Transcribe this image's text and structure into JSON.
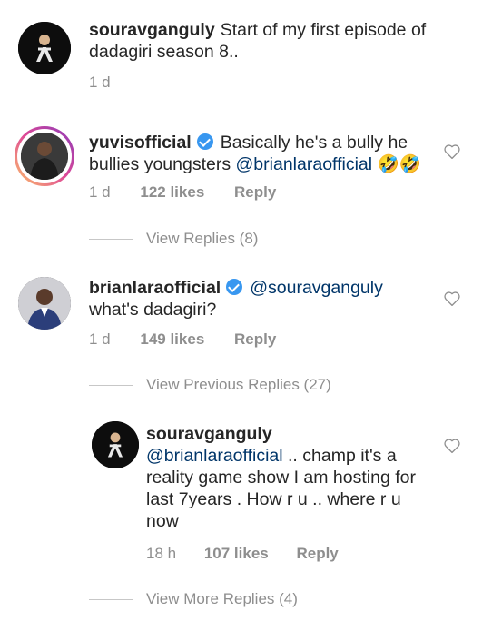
{
  "comments": [
    {
      "username": "souravganguly",
      "text": "Start of my first episode of dadagiri season 8..",
      "time": "1 d"
    },
    {
      "username": "yuvisofficial",
      "verified": true,
      "text_before": "Basically he's a bully he bullies youngsters ",
      "mention": "@brianlaraofficial",
      "text_after": " 🤣🤣",
      "time": "1 d",
      "likes": "122 likes",
      "reply": "Reply",
      "view_replies": "View Replies (8)"
    },
    {
      "username": "brianlaraofficial",
      "verified": true,
      "mention": "@souravganguly",
      "text_after": "what's dadagiri?",
      "time": "1 d",
      "likes": "149 likes",
      "reply": "Reply",
      "view_previous": "View Previous Replies (27)"
    },
    {
      "username": "souravganguly",
      "mention": "@brianlaraofficial",
      "text_after": " .. champ it's a reality game show I am hosting for last 7years . How r u .. where r u now",
      "time": "18 h",
      "likes": "107 likes",
      "reply": "Reply",
      "view_more": "View More Replies (4)"
    }
  ],
  "icons": {
    "heart": "heart-outline-icon",
    "verified": "verified-badge-icon"
  },
  "colors": {
    "text": "#262626",
    "muted": "#8e8e8e",
    "verified": "#3897f0"
  }
}
